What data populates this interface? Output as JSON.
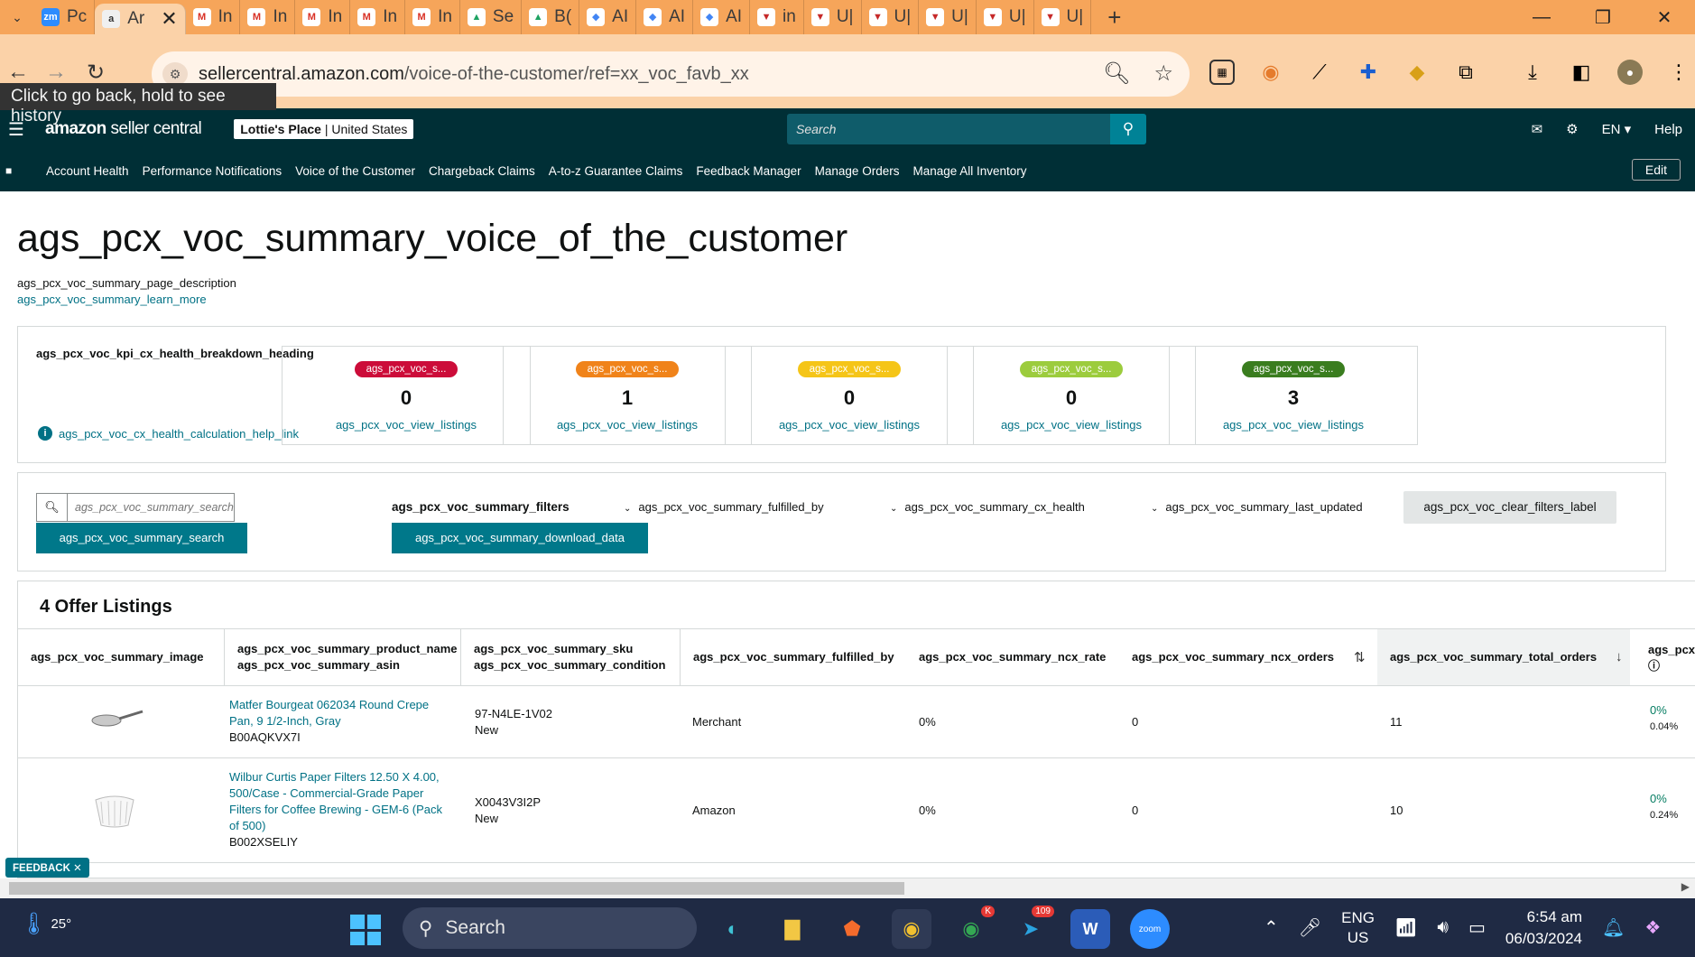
{
  "browser": {
    "tabs": [
      {
        "label": "Pc",
        "icon": "zoom-icon"
      },
      {
        "label": "Ar",
        "icon": "amazon-icon",
        "active": true
      },
      {
        "label": "In",
        "icon": "gmail-icon"
      },
      {
        "label": "In",
        "icon": "gmail-icon"
      },
      {
        "label": "In",
        "icon": "gmail-icon"
      },
      {
        "label": "In",
        "icon": "gmail-icon"
      },
      {
        "label": "In",
        "icon": "gmail-icon"
      },
      {
        "label": "Se",
        "icon": "drive-icon"
      },
      {
        "label": "B(",
        "icon": "drive-icon"
      },
      {
        "label": "AI",
        "icon": "ai-icon"
      },
      {
        "label": "AI",
        "icon": "ai-icon"
      },
      {
        "label": "AI",
        "icon": "ai-icon"
      },
      {
        "label": "in",
        "icon": "shop-icon"
      },
      {
        "label": "U|",
        "icon": "shop-icon"
      },
      {
        "label": "U|",
        "icon": "shop-icon"
      },
      {
        "label": "U|",
        "icon": "shop-icon"
      },
      {
        "label": "U|",
        "icon": "shop-icon"
      },
      {
        "label": "U|",
        "icon": "shop-icon"
      }
    ],
    "url_domain": "sellercentral.amazon.com",
    "url_path": "/voice-of-the-customer/ref=xx_voc_favb_xx",
    "tooltip": "Click to go back, hold to see history"
  },
  "header": {
    "logo_bold": "amazon",
    "logo_rest": " seller central",
    "store_name": "Lottie's Place",
    "store_region": "United States",
    "search_placeholder": "Search",
    "lang": "EN",
    "help": "Help"
  },
  "nav": {
    "items": [
      "Account Health",
      "Performance Notifications",
      "Voice of the Customer",
      "Chargeback Claims",
      "A-to-z Guarantee Claims",
      "Feedback Manager",
      "Manage Orders",
      "Manage All Inventory"
    ],
    "edit": "Edit"
  },
  "page": {
    "title": "ags_pcx_voc_summary_voice_of_the_customer",
    "description": "ags_pcx_voc_summary_page_description",
    "learn_more": "ags_pcx_voc_summary_learn_more"
  },
  "kpi": {
    "heading": "ags_pcx_voc_kpi_cx_health_breakdown_heading",
    "help_link": "ags_pcx_voc_cx_health_calculation_help_link",
    "cards": [
      {
        "badge": "ags_pcx_voc_s...",
        "color": "#cc0c39",
        "value": "0",
        "link": "ags_pcx_voc_view_listings"
      },
      {
        "badge": "ags_pcx_voc_s...",
        "color": "#f0831a",
        "value": "1",
        "link": "ags_pcx_voc_view_listings"
      },
      {
        "badge": "ags_pcx_voc_s...",
        "color": "#f5c518",
        "value": "0",
        "link": "ags_pcx_voc_view_listings"
      },
      {
        "badge": "ags_pcx_voc_s...",
        "color": "#9ccc3d",
        "value": "0",
        "link": "ags_pcx_voc_view_listings"
      },
      {
        "badge": "ags_pcx_voc_s...",
        "color": "#3a7d1f",
        "value": "3",
        "link": "ags_pcx_voc_view_listings"
      }
    ]
  },
  "filters": {
    "search_placeholder": "ags_pcx_voc_summary_search",
    "search_button": "ags_pcx_voc_summary_search",
    "filters_label": "ags_pcx_voc_summary_filters",
    "download": "ags_pcx_voc_summary_download_data",
    "fulfilled_by": "ags_pcx_voc_summary_fulfilled_by",
    "cx_health": "ags_pcx_voc_summary_cx_health",
    "last_updated": "ags_pcx_voc_summary_last_updated",
    "clear": "ags_pcx_voc_clear_filters_label"
  },
  "table": {
    "title": "4 Offer Listings",
    "headers": {
      "image": "ags_pcx_voc_summary_image",
      "product_name": "ags_pcx_voc_summary_product_name",
      "asin": "ags_pcx_voc_summary_asin",
      "sku": "ags_pcx_voc_summary_sku",
      "condition": "ags_pcx_voc_summary_condition",
      "fulfilled_by": "ags_pcx_voc_summary_fulfilled_by",
      "ncx_rate": "ags_pcx_voc_summary_ncx_rate",
      "ncx_orders": "ags_pcx_voc_summary_ncx_orders",
      "total_orders": "ags_pcx_voc_summary_total_orders",
      "next": "ags_pcx"
    },
    "rows": [
      {
        "name": "Matfer Bourgeat 062034 Round Crepe Pan, 9 1/2-Inch, Gray",
        "asin": "B00AQKVX7I",
        "sku": "97-N4LE-1V02",
        "condition": "New",
        "fulfilled_by": "Merchant",
        "ncx_rate": "0%",
        "ncx_orders": "0",
        "total_orders": "11",
        "next_pct": "0%",
        "next_sub": "0.04%"
      },
      {
        "name": "Wilbur Curtis Paper Filters 12.50 X 4.00, 500/Case - Commercial-Grade Paper Filters for Coffee Brewing - GEM-6 (Pack of 500)",
        "asin": "B002XSELIY",
        "sku": "X0043V3I2P",
        "condition": "New",
        "fulfilled_by": "Amazon",
        "ncx_rate": "0%",
        "ncx_orders": "0",
        "total_orders": "10",
        "next_pct": "0%",
        "next_sub": "0.24%"
      }
    ]
  },
  "feedback": "FEEDBACK",
  "taskbar": {
    "temp": "25°",
    "search": "Search",
    "telegram_badge": "109",
    "chrome_badge": "K",
    "lang_top": "ENG",
    "lang_bottom": "US",
    "time": "6:54 am",
    "date": "06/03/2024"
  }
}
